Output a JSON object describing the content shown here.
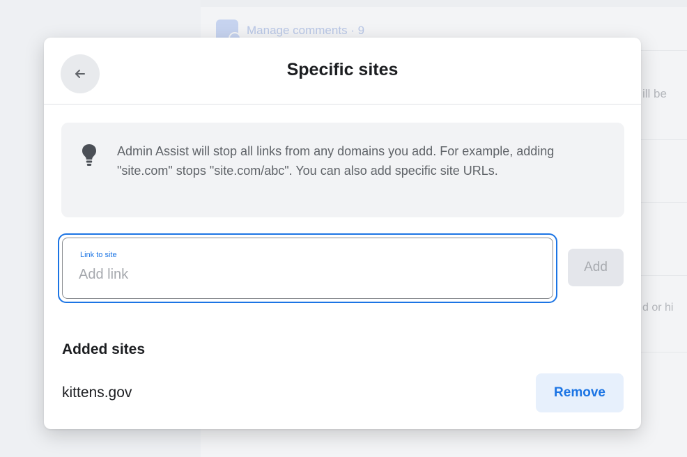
{
  "background": {
    "header_text": "Manage comments · 9",
    "snippet_1": "ill be",
    "snippet_2": "d or hi"
  },
  "dialog": {
    "title": "Specific sites",
    "back_icon": "arrow-left-icon",
    "info": {
      "icon": "lightbulb-icon",
      "text": "Admin Assist will stop all links from any domains you add. For example, adding \"site.com\" stops \"site.com/abc\". You can also add specific site URLs."
    },
    "link_field": {
      "label": "Link to site",
      "placeholder": "Add link",
      "value": ""
    },
    "add_label": "Add",
    "added_sites_heading": "Added sites",
    "sites": [
      {
        "name": "kittens.gov",
        "remove_label": "Remove"
      }
    ]
  },
  "colors": {
    "accent": "#1b74e4",
    "remove_bg": "#e7f0fc",
    "disabled_bg": "#e4e6eb"
  }
}
